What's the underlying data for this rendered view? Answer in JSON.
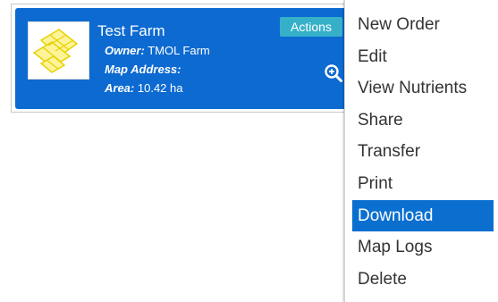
{
  "card": {
    "title": "Test Farm",
    "owner_label": "Owner:",
    "owner_value": "TMOL Farm",
    "map_address_label": "Map Address:",
    "map_address_value": "",
    "area_label": "Area:",
    "area_value": "10.42 ha",
    "actions_label": "Actions",
    "thumbnail_icon": "field-map-icon",
    "zoom_icon": "zoom-in-icon"
  },
  "menu": {
    "items": [
      {
        "label": "New Order"
      },
      {
        "label": "Edit"
      },
      {
        "label": "View Nutrients"
      },
      {
        "label": "Share"
      },
      {
        "label": "Transfer"
      },
      {
        "label": "Print"
      },
      {
        "label": "Download"
      },
      {
        "label": "Map Logs"
      },
      {
        "label": "Delete"
      }
    ],
    "active_item": "Download"
  },
  "colors": {
    "card_bg": "#0d6ad1",
    "actions_bg": "#36b0c9",
    "menu_active_bg": "#0b6fd0",
    "field_fill": "#fff39a",
    "field_stroke": "#e6d200"
  }
}
